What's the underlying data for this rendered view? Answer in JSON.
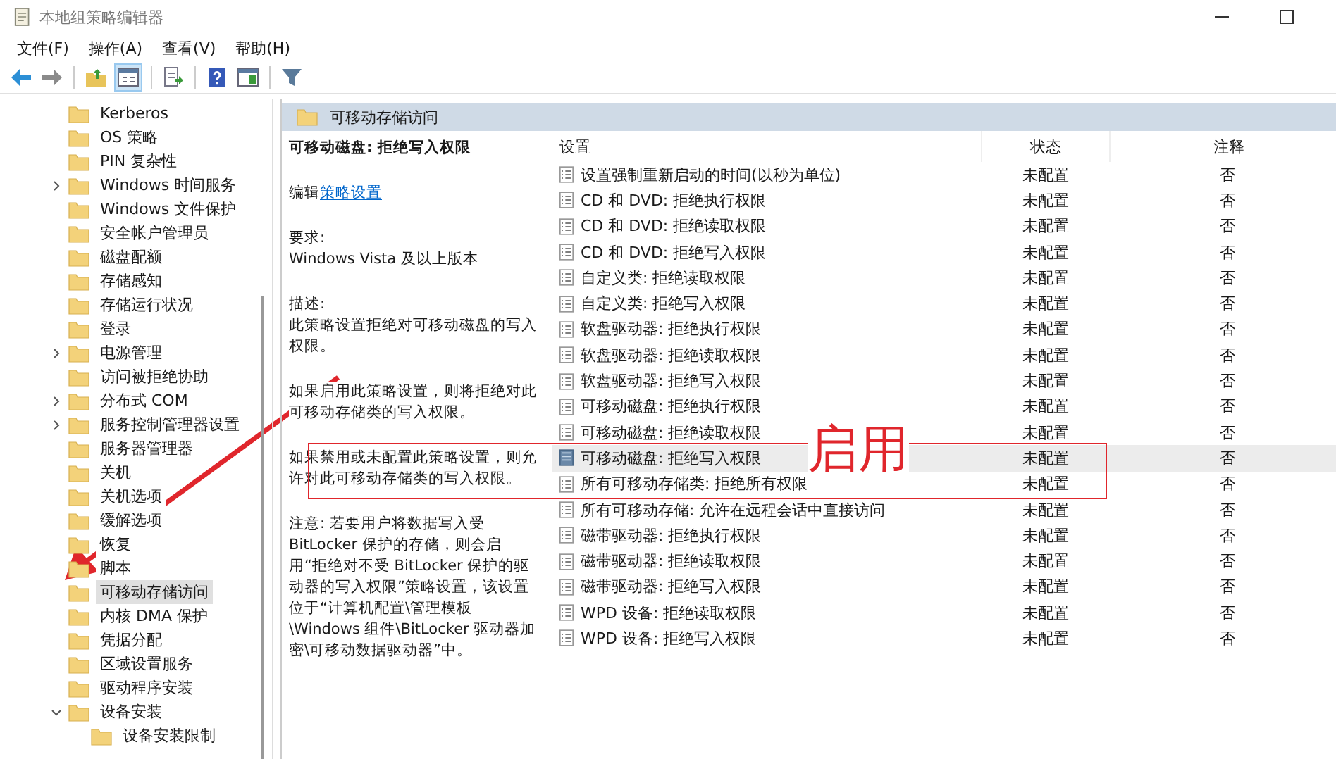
{
  "window": {
    "title": "本地组策略编辑器"
  },
  "menu": [
    "文件(F)",
    "操作(A)",
    "查看(V)",
    "帮助(H)"
  ],
  "toolbar": [
    {
      "kind": "back"
    },
    {
      "kind": "forward"
    },
    {
      "kind": "sep"
    },
    {
      "kind": "up"
    },
    {
      "kind": "tree"
    },
    {
      "kind": "sep"
    },
    {
      "kind": "export"
    },
    {
      "kind": "sep"
    },
    {
      "kind": "help"
    },
    {
      "kind": "view"
    },
    {
      "kind": "sep"
    },
    {
      "kind": "filter"
    }
  ],
  "tree": [
    {
      "label": "Kerberos",
      "kind": "leaf",
      "selected": false
    },
    {
      "label": "OS 策略",
      "kind": "leaf",
      "selected": false
    },
    {
      "label": "PIN 复杂性",
      "kind": "leaf",
      "selected": false
    },
    {
      "label": "Windows 时间服务",
      "kind": "closed",
      "selected": false
    },
    {
      "label": "Windows 文件保护",
      "kind": "leaf",
      "selected": false
    },
    {
      "label": "安全帐户管理员",
      "kind": "leaf",
      "selected": false
    },
    {
      "label": "磁盘配额",
      "kind": "leaf",
      "selected": false
    },
    {
      "label": "存储感知",
      "kind": "leaf",
      "selected": false
    },
    {
      "label": "存储运行状况",
      "kind": "leaf",
      "selected": false
    },
    {
      "label": "登录",
      "kind": "leaf",
      "selected": false
    },
    {
      "label": "电源管理",
      "kind": "closed",
      "selected": false
    },
    {
      "label": "访问被拒绝协助",
      "kind": "leaf",
      "selected": false
    },
    {
      "label": "分布式 COM",
      "kind": "closed",
      "selected": false
    },
    {
      "label": "服务控制管理器设置",
      "kind": "closed",
      "selected": false
    },
    {
      "label": "服务器管理器",
      "kind": "leaf",
      "selected": false
    },
    {
      "label": "关机",
      "kind": "leaf",
      "selected": false
    },
    {
      "label": "关机选项",
      "kind": "leaf",
      "selected": false
    },
    {
      "label": "缓解选项",
      "kind": "leaf",
      "selected": false
    },
    {
      "label": "恢复",
      "kind": "leaf",
      "selected": false
    },
    {
      "label": "脚本",
      "kind": "leaf",
      "selected": false
    },
    {
      "label": "可移动存储访问",
      "kind": "leaf",
      "selected": true
    },
    {
      "label": "内核 DMA 保护",
      "kind": "leaf",
      "selected": false
    },
    {
      "label": "凭据分配",
      "kind": "leaf",
      "selected": false
    },
    {
      "label": "区域设置服务",
      "kind": "leaf",
      "selected": false
    },
    {
      "label": "驱动程序安装",
      "kind": "leaf",
      "selected": false
    },
    {
      "label": "设备安装",
      "kind": "open",
      "selected": false,
      "children": [
        {
          "label": "设备安装限制",
          "selected": false
        }
      ]
    }
  ],
  "header": {
    "title": "可移动存储访问"
  },
  "description": {
    "title": "可移动磁盘: 拒绝写入权限",
    "edit_prefix": "编辑",
    "edit_link": "策略设置",
    "paragraphs": [
      "要求:\nWindows Vista 及以上版本",
      "描述:\n此策略设置拒绝对可移动磁盘的写入权限。",
      "如果启用此策略设置，则将拒绝对此可移动存储类的写入权限。",
      "如果禁用或未配置此策略设置，则允许对此可移动存储类的写入权限。",
      "注意: 若要用户将数据写入受 BitLocker 保护的存储，则会启用“拒绝对不受 BitLocker 保护的驱动器的写入权限”策略设置，该设置位于“计算机配置\\管理模板\\Windows 组件\\BitLocker 驱动器加密\\可移动数据驱动器”中。"
    ]
  },
  "table": {
    "columns": [
      "设置",
      "状态",
      "注释"
    ],
    "rows": [
      {
        "setting": "设置强制重新启动的时间(以秒为单位)",
        "state": "未配置",
        "comment": "否",
        "selected": false
      },
      {
        "setting": "CD 和 DVD: 拒绝执行权限",
        "state": "未配置",
        "comment": "否",
        "selected": false
      },
      {
        "setting": "CD 和 DVD: 拒绝读取权限",
        "state": "未配置",
        "comment": "否",
        "selected": false
      },
      {
        "setting": "CD 和 DVD: 拒绝写入权限",
        "state": "未配置",
        "comment": "否",
        "selected": false
      },
      {
        "setting": "自定义类: 拒绝读取权限",
        "state": "未配置",
        "comment": "否",
        "selected": false
      },
      {
        "setting": "自定义类: 拒绝写入权限",
        "state": "未配置",
        "comment": "否",
        "selected": false
      },
      {
        "setting": "软盘驱动器: 拒绝执行权限",
        "state": "未配置",
        "comment": "否",
        "selected": false
      },
      {
        "setting": "软盘驱动器: 拒绝读取权限",
        "state": "未配置",
        "comment": "否",
        "selected": false
      },
      {
        "setting": "软盘驱动器: 拒绝写入权限",
        "state": "未配置",
        "comment": "否",
        "selected": false
      },
      {
        "setting": "可移动磁盘: 拒绝执行权限",
        "state": "未配置",
        "comment": "否",
        "selected": false
      },
      {
        "setting": "可移动磁盘: 拒绝读取权限",
        "state": "未配置",
        "comment": "否",
        "selected": false
      },
      {
        "setting": "可移动磁盘: 拒绝写入权限",
        "state": "未配置",
        "comment": "否",
        "selected": true
      },
      {
        "setting": "所有可移动存储类: 拒绝所有权限",
        "state": "未配置",
        "comment": "否",
        "selected": false
      },
      {
        "setting": "所有可移动存储: 允许在远程会话中直接访问",
        "state": "未配置",
        "comment": "否",
        "selected": false
      },
      {
        "setting": "磁带驱动器: 拒绝执行权限",
        "state": "未配置",
        "comment": "否",
        "selected": false
      },
      {
        "setting": "磁带驱动器: 拒绝读取权限",
        "state": "未配置",
        "comment": "否",
        "selected": false
      },
      {
        "setting": "磁带驱动器: 拒绝写入权限",
        "state": "未配置",
        "comment": "否",
        "selected": false
      },
      {
        "setting": "WPD 设备: 拒绝读取权限",
        "state": "未配置",
        "comment": "否",
        "selected": false
      },
      {
        "setting": "WPD 设备: 拒绝写入权限",
        "state": "未配置",
        "comment": "否",
        "selected": false
      }
    ]
  },
  "annotation": {
    "label": "启用"
  }
}
